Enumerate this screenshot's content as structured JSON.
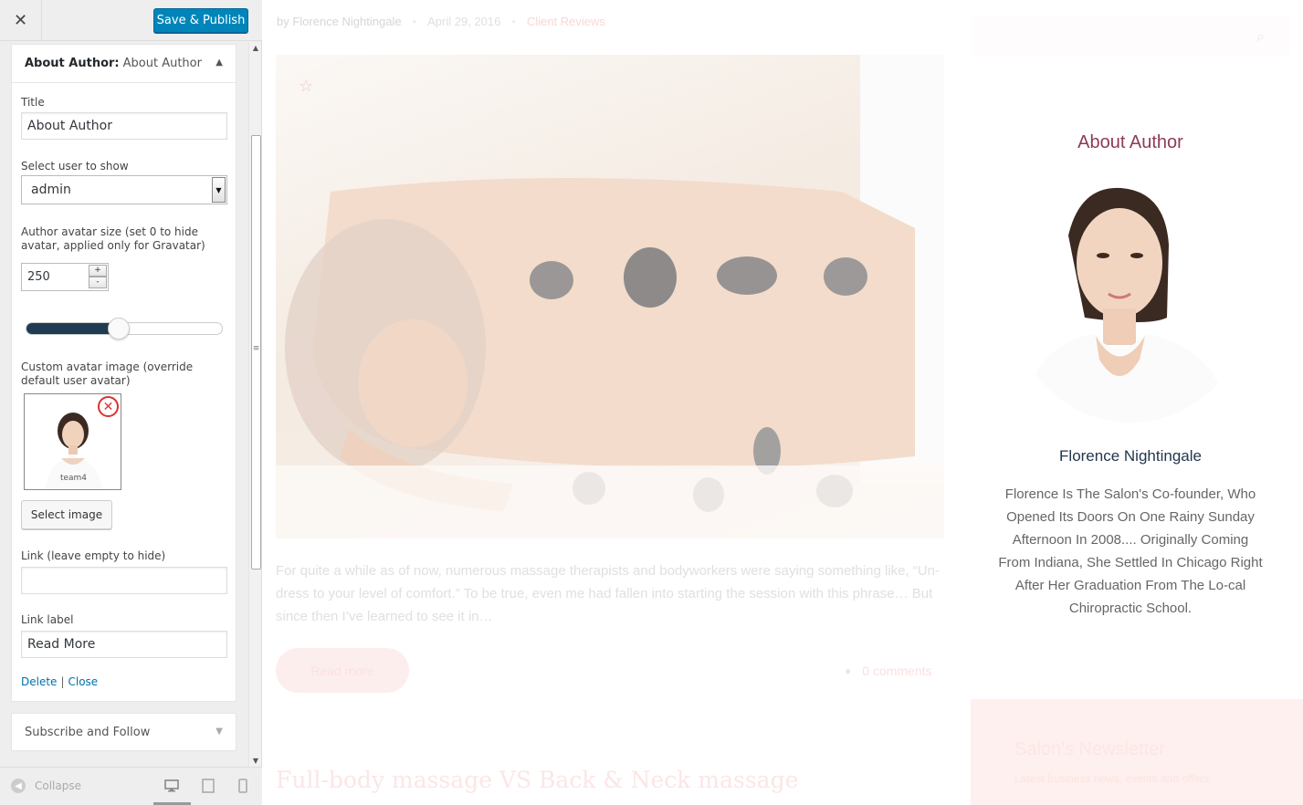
{
  "topbar": {
    "close_icon": "close-icon",
    "save_label": "Save & Publish"
  },
  "widget": {
    "header_strong": "About Author:",
    "header_light": "About Author",
    "title_label": "Title",
    "title_value": "About Author",
    "user_label": "Select user to show",
    "user_value": "admin",
    "avatar_size_label": "Author avatar size (set 0 to hide avatar, applied only for Gravatar)",
    "avatar_size_value": "250",
    "slider_fraction": 0.47,
    "custom_avatar_label": "Custom avatar image (override default user avatar)",
    "thumb_caption": "team4",
    "select_image_label": "Select image",
    "link_label": "Link (leave empty to hide)",
    "link_value": "",
    "link_label_label": "Link label",
    "link_label_value": "Read More",
    "delete_label": "Delete",
    "separator": "|",
    "close_label": "Close"
  },
  "widget2": {
    "title": "Subscribe and Follow"
  },
  "footer": {
    "collapse_label": "Collapse"
  },
  "preview": {
    "meta_author": "by Florence Nightingale",
    "meta_date": "April 29, 2016",
    "meta_category": "Client Reviews",
    "excerpt": "For quite a while as of now, numerous massage therapists and bodyworkers were saying something like, “Un-dress to your level of comfort.” To be true, even me had fallen into starting the session with this phrase… But since then I’ve learned to see it in…",
    "read_more": "Read more",
    "comments": "0 comments",
    "next_title": "Full-body massage VS Back & Neck massage"
  },
  "aside": {
    "title": "About Author",
    "author_name": "Florence Nightingale",
    "bio": "Florence Is The Salon's Co-founder, Who Opened Its Doors On One Rainy Sunday Afternoon In 2008.... Originally Coming From Indiana, She Settled In Chicago Right After Her Graduation From The Lo-cal Chiropractic School.",
    "newsletter_title": "Salon's Newsletter",
    "newsletter_sub": "Latest business news, events and offers"
  },
  "colors": {
    "accent": "#0085ba",
    "aside_title": "#8e3a5a",
    "author_name": "#23364d"
  }
}
